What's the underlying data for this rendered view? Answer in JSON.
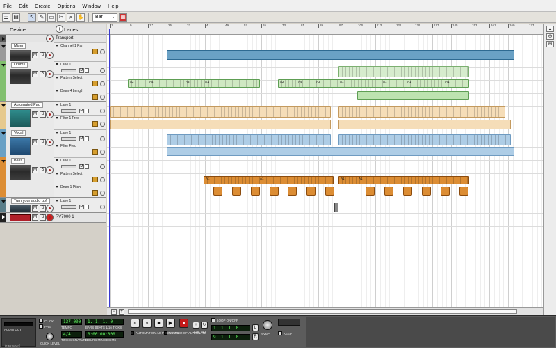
{
  "menu": [
    "File",
    "Edit",
    "Create",
    "Options",
    "Window",
    "Help"
  ],
  "toolbar": {
    "snap_value": "Bar"
  },
  "header": {
    "device": "Device",
    "lanes": "Lanes"
  },
  "tracks": {
    "transport": "Transport",
    "mixer": "Mixer",
    "drums": "Drums",
    "pad": "Automated Pad",
    "vocal": "Vocal",
    "bass": "Bass",
    "loop": "Turn your audio up!",
    "rv7000": "RV7000 1"
  },
  "lanes": {
    "mixer_a": "Channel 1 Pan",
    "drums_a": "Lane 1",
    "drums_b": "Pattern Select",
    "drums_c": "Drum 4 Length",
    "pad_a": "Lane 1",
    "pad_b": "Filter 1 Freq",
    "vocal_a": "Lane 1",
    "vocal_b": "Filter Freq",
    "bass_a": "Lane 1",
    "bass_b": "Pattern Select",
    "bass_c": "Drum 1 Pitch",
    "loop_a": "Lane 1"
  },
  "ruler": [
    "1",
    "9",
    "17",
    "25",
    "33",
    "41",
    "49",
    "57",
    "65",
    "73",
    "81",
    "89",
    "97",
    "105",
    "113",
    "121",
    "129",
    "137",
    "145",
    "153",
    "161",
    "169",
    "177"
  ],
  "clips": {
    "drum_pat": [
      "A2",
      "A4",
      "A3",
      "A1",
      "A2",
      "A4",
      "A3",
      "A1",
      "A1",
      "A1",
      "A1"
    ],
    "bass_pat": [
      "A1",
      "A1",
      "A1",
      "A1"
    ]
  },
  "transport": {
    "audio_out": "AUDIO OUT",
    "click": "CLICK",
    "pre": "PRE",
    "click_level": "CLICK LEVEL",
    "tempo": "137.000",
    "tempo_label": "TEMPO",
    "signature": "4/4",
    "sig_label": "TIME SIGNATURE",
    "pos": "1. 1. 1. 0",
    "pos_label": "BARS BEATS 1/16 TICKS",
    "time": "0:00:00:000",
    "time_label": "HOURS MIN SEC MS",
    "loop_on": "LOOP ON/OFF",
    "lpos": "1. 1. 1. 0",
    "rpos": "9. 1. 1. 0",
    "q_rec": "AUTOMATION AS PERF CTRL",
    "reduced": "NUMBER OF ALTERNATE",
    "dub": "DUB",
    "alt": "ALT",
    "sync": "SYNC",
    "keep": "KEEP",
    "logo": "transport"
  },
  "colors": {
    "mixer": "#8c8c8c",
    "drums": "#78b86a",
    "pad": "#e3c58a",
    "vocal": "#6aa1c5",
    "bass": "#dc8d34",
    "loop": "#5a7e8a"
  }
}
